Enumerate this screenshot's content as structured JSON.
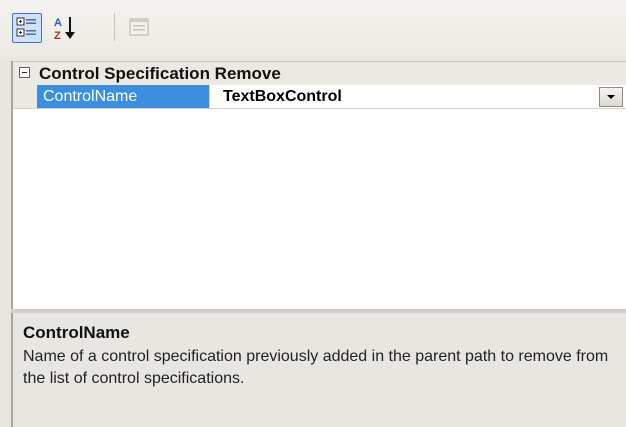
{
  "toolbar": {
    "buttons": [
      {
        "icon": "categorized-icon",
        "active": true
      },
      {
        "icon": "sort-alphabetical-icon",
        "active": false
      },
      {
        "icon": "property-pages-icon",
        "active": false,
        "disabled": true
      }
    ]
  },
  "grid": {
    "category": {
      "label": "Control Specification Remove",
      "expanded": true
    },
    "properties": [
      {
        "name": "ControlName",
        "value": "TextBoxControl",
        "selected": true
      }
    ]
  },
  "description": {
    "title": "ControlName",
    "text": "Name of a control specification previously added in the parent path to remove from the list of control specifications."
  },
  "colors": {
    "selection": "#3b8fde",
    "panel": "#e8e6e0",
    "active_button_border": "#3d74c7"
  }
}
